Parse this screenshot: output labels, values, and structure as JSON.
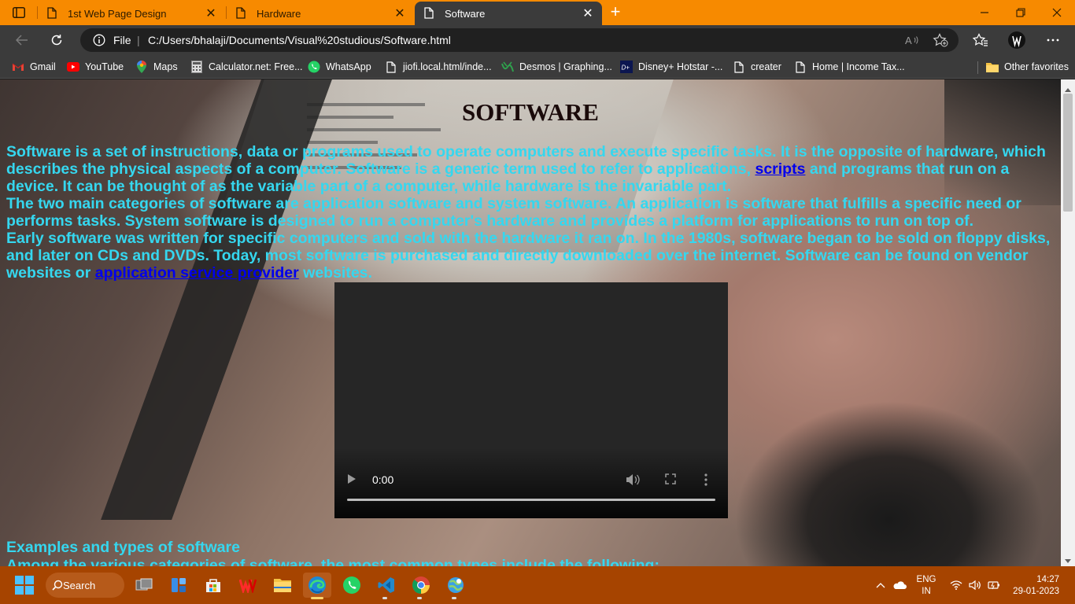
{
  "browser": {
    "tabs": [
      {
        "title": "1st Web Page Design",
        "active": false
      },
      {
        "title": "Hardware",
        "active": false
      },
      {
        "title": "Software",
        "active": true
      }
    ],
    "address": {
      "scheme": "File",
      "url": "C:/Users/bhalaji/Documents/Visual%20studious/Software.html"
    },
    "favorites": [
      {
        "label": "Gmail",
        "icon": "gmail-icon"
      },
      {
        "label": "YouTube",
        "icon": "youtube-icon"
      },
      {
        "label": "Maps",
        "icon": "maps-icon"
      },
      {
        "label": "Calculator.net: Free...",
        "icon": "calculator-icon"
      },
      {
        "label": "WhatsApp",
        "icon": "whatsapp-icon"
      },
      {
        "label": "jiofi.local.html/inde...",
        "icon": "page-icon"
      },
      {
        "label": "Desmos | Graphing...",
        "icon": "desmos-icon"
      },
      {
        "label": "Disney+ Hotstar -...",
        "icon": "hotstar-icon"
      },
      {
        "label": "creater",
        "icon": "page-icon"
      },
      {
        "label": "Home | Income Tax...",
        "icon": "page-icon"
      }
    ],
    "other_favorites": "Other favorites"
  },
  "page": {
    "heading": "SOFTWARE",
    "p1": {
      "before": "Software is a set of instructions, data or programs used to operate computers and execute specific tasks. It is the opposite of hardware, which describes the physical aspects of a computer. Software is a generic term used to refer to applications, ",
      "link": "scripts",
      "after": " and programs that run on a device. It can be thought of as the variable part of a computer, while hardware is the invariable part."
    },
    "p2": "The two main categories of software are application software and system software. An application is software that fulfills a specific need or performs tasks. System software is designed to run a computer's hardware and provides a platform for applications to run on top of.",
    "p3": {
      "before": "Early software was written for specific computers and sold with the hardware it ran on. In the 1980s, software began to be sold on floppy disks, and later on CDs and DVDs. Today, most software is purchased and directly downloaded over the internet. Software can be found on vendor websites or ",
      "link": "application service provider",
      "after": " websites."
    },
    "video": {
      "time": "0:00",
      "progress": 0
    },
    "h2": "Examples and types of software",
    "p4": "Among the various categories of software, the most common types include the following:"
  },
  "taskbar": {
    "search_label": "Search",
    "apps": [
      "task-view-icon",
      "widgets-icon",
      "store-icon",
      "wps-icon",
      "file-explorer-icon",
      "edge-icon",
      "whatsapp-icon",
      "vscode-icon",
      "chrome-icon",
      "maps-app-icon"
    ],
    "language": {
      "line1": "ENG",
      "line2": "IN"
    },
    "time": "14:27",
    "date": "29-01-2023"
  },
  "colors": {
    "tabstrip": "#f78a00",
    "toolbar": "#3b3b3b",
    "body_text": "#35d7ef",
    "link": "#0000ee",
    "taskbar": "#a64400"
  }
}
